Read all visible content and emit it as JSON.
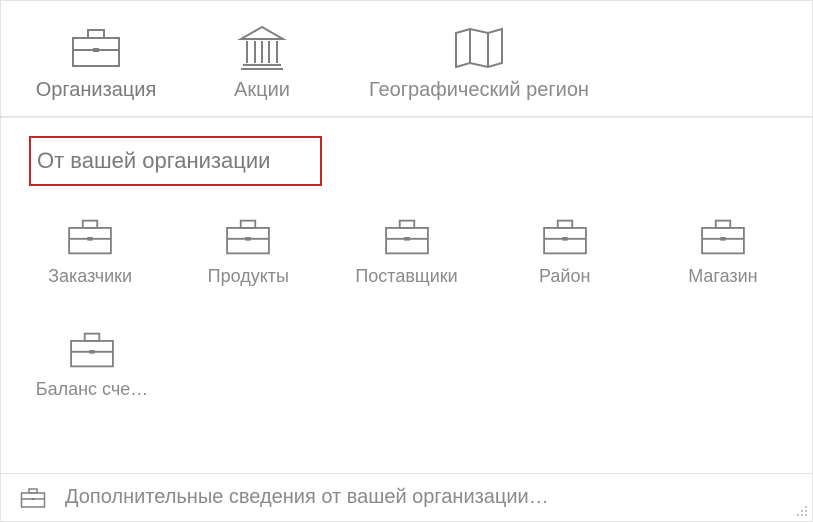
{
  "top_row": [
    {
      "label": "Организация",
      "icon": "briefcase"
    },
    {
      "label": "Акции",
      "icon": "bank"
    },
    {
      "label": "Географический регион",
      "icon": "map"
    }
  ],
  "section_header": "От вашей организации",
  "mid_row1": [
    {
      "label": "Заказчики",
      "icon": "briefcase"
    },
    {
      "label": "Продукты",
      "icon": "briefcase"
    },
    {
      "label": "Поставщики",
      "icon": "briefcase"
    },
    {
      "label": "Район",
      "icon": "briefcase"
    },
    {
      "label": "Магазин",
      "icon": "briefcase"
    }
  ],
  "mid_row2": [
    {
      "label": "Баланс сче…",
      "icon": "briefcase"
    }
  ],
  "footer": {
    "icon": "briefcase",
    "text": "Дополнительные сведения от вашей организации…"
  },
  "colors": {
    "icon_stroke": "#808080",
    "text": "#8a8a8a",
    "highlight_border": "#c62828"
  }
}
